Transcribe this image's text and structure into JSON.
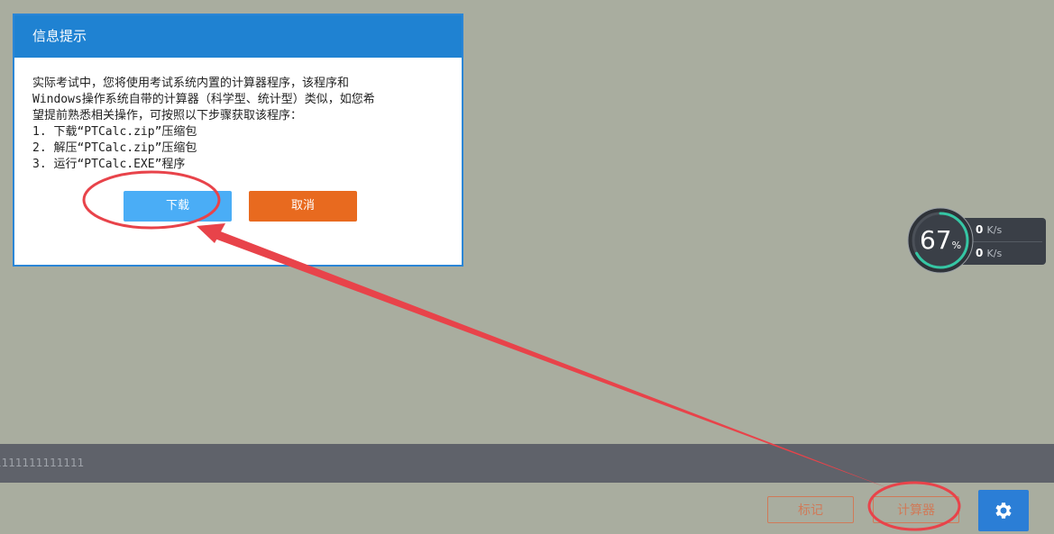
{
  "dialog": {
    "title": "信息提示",
    "lines": [
      "实际考试中，您将使用考试系统内置的计算器程序，该程序和",
      "Windows操作系统自带的计算器（科学型、统计型）类似，如您希",
      "望提前熟悉相关操作，可按照以下步骤获取该程序：",
      "1. 下载“PTCalc.zip”压缩包",
      "2. 解压“PTCalc.zip”压缩包",
      "3. 运行“PTCalc.EXE”程序"
    ],
    "download_label": "下载",
    "cancel_label": "取消"
  },
  "speed_widget": {
    "percent": "67",
    "percent_sign": "%",
    "upload_value": "0",
    "download_value": "0",
    "unit": "K/s"
  },
  "status_bar": {
    "text": "1111111111111"
  },
  "toolbar": {
    "mark_label": "标记",
    "calculator_label": "计算器"
  },
  "colors": {
    "background": "#a9ad9f",
    "dialog_header": "#1f82d2",
    "download_button": "#4aadf6",
    "cancel_button": "#e86a1f",
    "annotation": "#e8434a",
    "settings_button": "#2b7ed6"
  },
  "icons": {
    "settings": "gear-icon",
    "upload": "arrow-up-icon",
    "download": "arrow-down-icon"
  }
}
